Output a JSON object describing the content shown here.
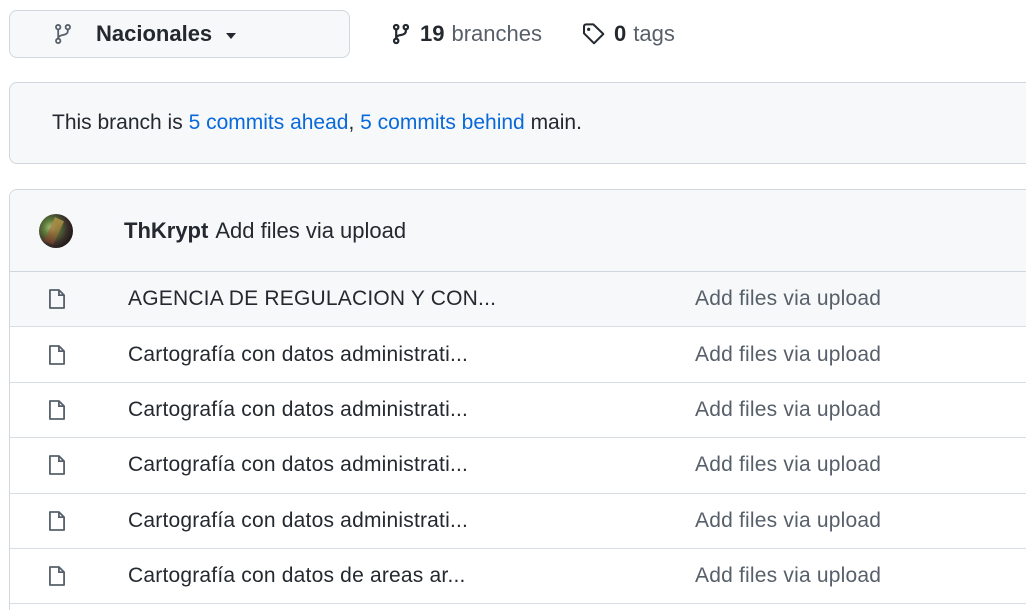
{
  "branch_selector": {
    "label": "Nacionales",
    "icon": "git-branch-icon"
  },
  "branches_link": {
    "count": "19",
    "label": "branches",
    "icon": "git-branch-icon"
  },
  "tags_link": {
    "count": "0",
    "label": "tags",
    "icon": "tag-icon"
  },
  "notice": {
    "prefix": "This branch is ",
    "ahead": "5 commits ahead",
    "separator": ", ",
    "behind": "5 commits behind",
    "suffix": " main."
  },
  "latest_commit": {
    "author": "ThKrypt",
    "message": "Add files via upload"
  },
  "files": [
    {
      "name": "AGENCIA DE REGULACION Y CON...",
      "commit": "Add files via upload",
      "icon": "file-icon"
    },
    {
      "name": "Cartografía con datos administrati...",
      "commit": "Add files via upload",
      "icon": "file-icon"
    },
    {
      "name": "Cartografía con datos administrati...",
      "commit": "Add files via upload",
      "icon": "file-icon"
    },
    {
      "name": "Cartografía con datos administrati...",
      "commit": "Add files via upload",
      "icon": "file-icon"
    },
    {
      "name": "Cartografía con datos administrati...",
      "commit": "Add files via upload",
      "icon": "file-icon"
    },
    {
      "name": "Cartografía con datos de areas ar...",
      "commit": "Add files via upload",
      "icon": "file-icon"
    }
  ],
  "colors": {
    "link": "#0969da",
    "muted": "#57606a",
    "border": "#d0d7de",
    "subtle_bg": "#f6f8fa"
  }
}
